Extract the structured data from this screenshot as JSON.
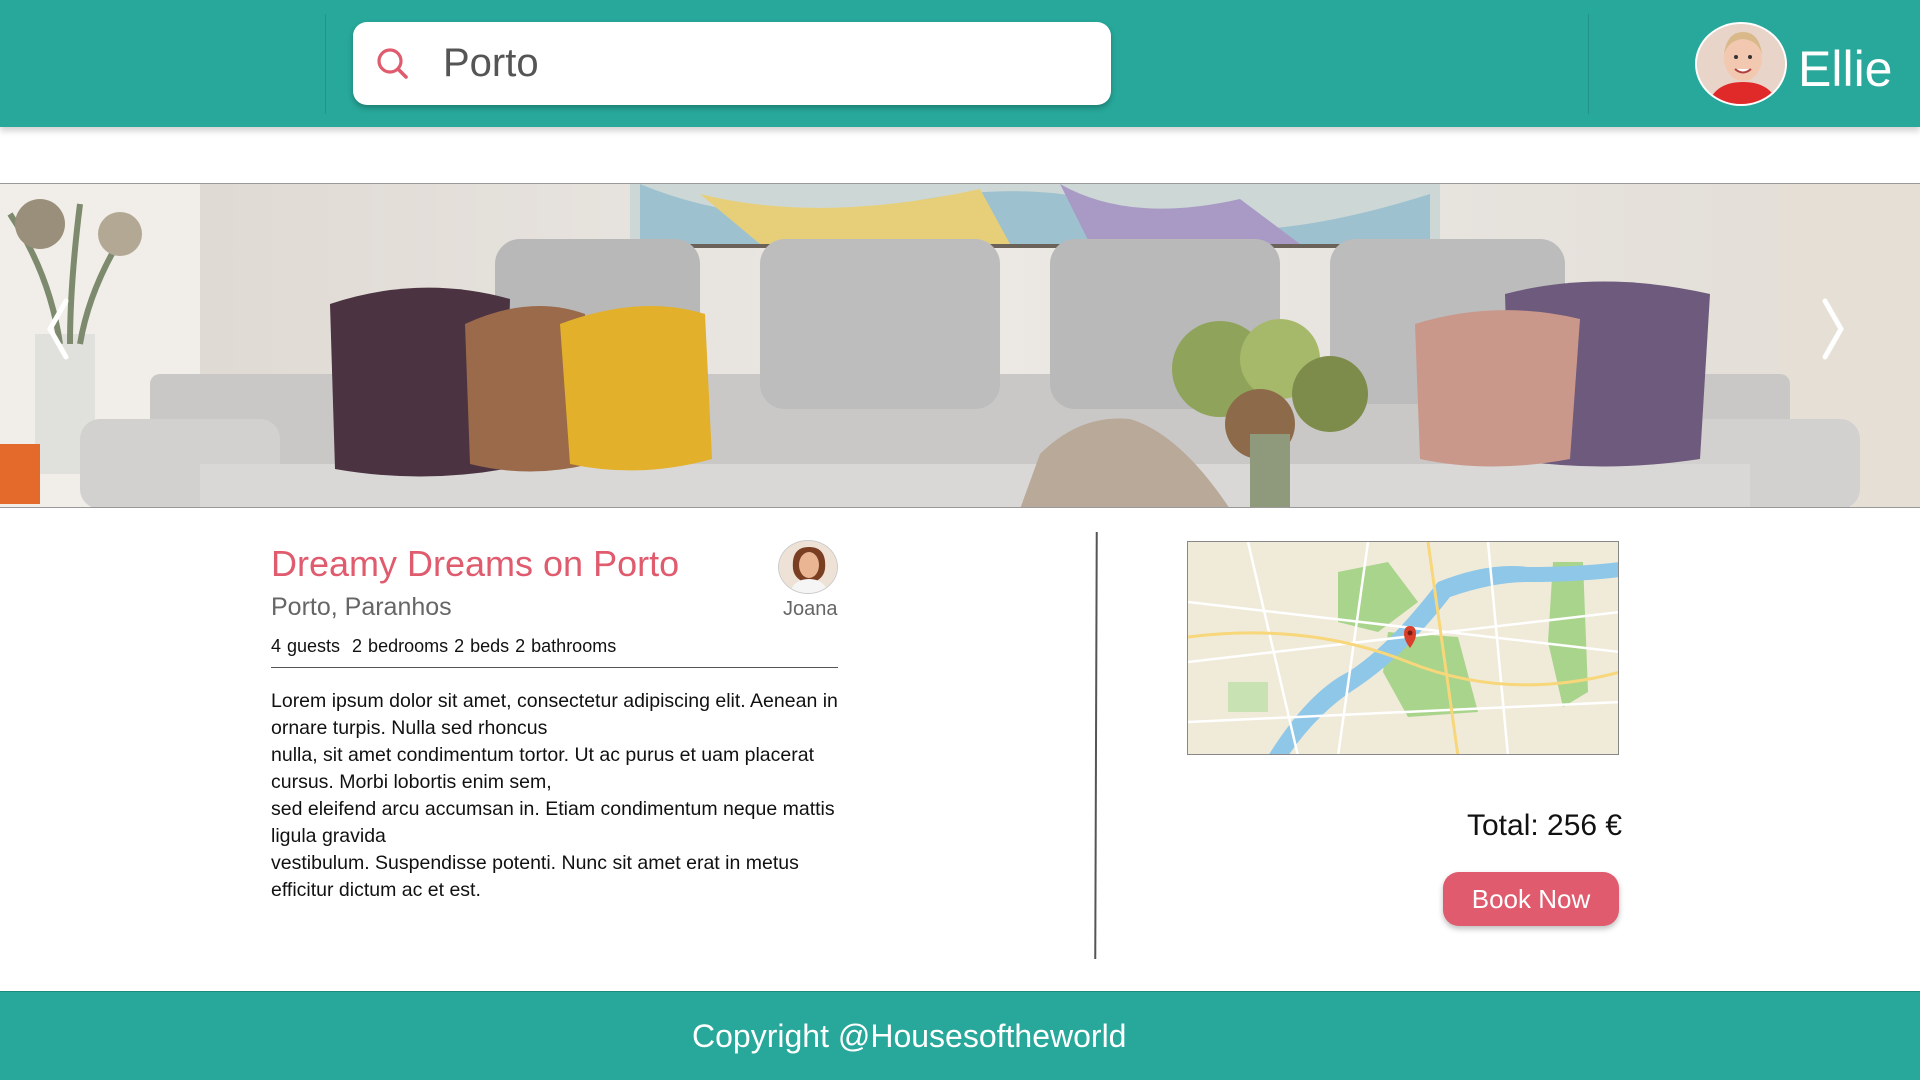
{
  "header": {
    "search": {
      "value": "Porto",
      "placeholder": "Search"
    },
    "user": {
      "name": "Ellie"
    }
  },
  "gallery": {
    "prev_icon": "chevron-left-icon",
    "next_icon": "chevron-right-icon"
  },
  "listing": {
    "title": "Dreamy Dreams on Porto",
    "location": "Porto, Paranhos",
    "specs": "4 guests  2 bedrooms 2 beds 2 bathrooms",
    "host": {
      "name": "Joana"
    },
    "description": [
      "Lorem ipsum dolor sit amet, consectetur adipiscing elit. Aenean in ornare turpis. Nulla sed rhoncus",
      "nulla, sit amet condimentum tortor. Ut ac purus et uam placerat cursus. Morbi lobortis enim sem,",
      "sed eleifend arcu accumsan in. Etiam condimentum neque mattis ligula gravida",
      "vestibulum. Suspendisse potenti. Nunc sit amet erat in metus efficitur dictum ac et est."
    ]
  },
  "booking": {
    "total": "Total: 256 €",
    "book_label": "Book Now"
  },
  "footer": {
    "copyright": "Copyright @Housesoftheworld"
  },
  "colors": {
    "teal": "#27a89a",
    "accent": "#df5b6d"
  }
}
